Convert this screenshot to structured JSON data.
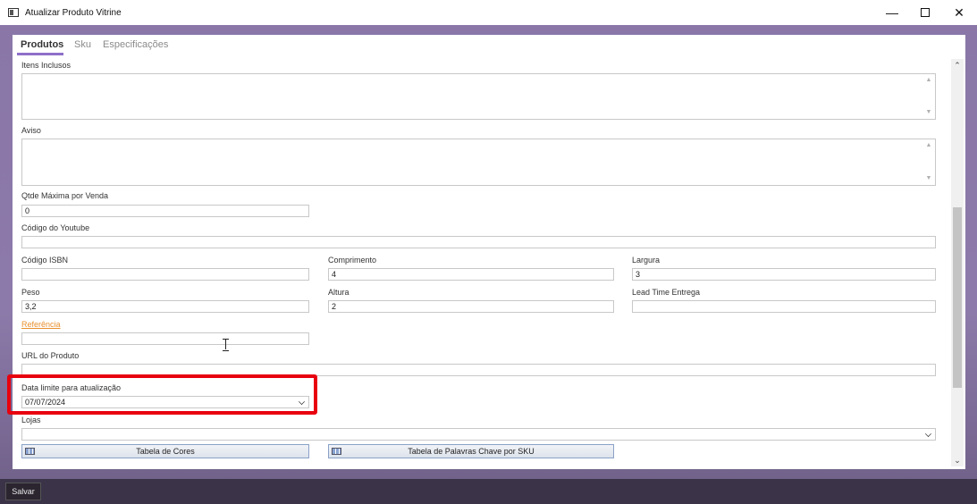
{
  "window": {
    "title": "Atualizar Produto Vitrine",
    "minimize": "—",
    "close": "✕"
  },
  "tabs": [
    {
      "label": "Produtos",
      "active": true
    },
    {
      "label": "Sku",
      "active": false
    },
    {
      "label": "Especificações",
      "active": false
    }
  ],
  "form": {
    "itens_inclusos": {
      "label": "Itens Inclusos",
      "value": ""
    },
    "aviso": {
      "label": "Aviso",
      "value": ""
    },
    "qtde_maxima": {
      "label": "Qtde Máxima por Venda",
      "value": "0"
    },
    "codigo_youtube": {
      "label": "Código do Youtube",
      "value": ""
    },
    "codigo_isbn": {
      "label": "Código ISBN",
      "value": ""
    },
    "comprimento": {
      "label": "Comprimento",
      "value": "4"
    },
    "largura": {
      "label": "Largura",
      "value": "3"
    },
    "peso": {
      "label": "Peso",
      "value": "3,2"
    },
    "altura": {
      "label": "Altura",
      "value": "2"
    },
    "lead_time": {
      "label": "Lead Time Entrega",
      "value": ""
    },
    "referencia": {
      "label": "Referência",
      "value": ""
    },
    "url_produto": {
      "label": "URL do Produto",
      "value": ""
    },
    "data_limite": {
      "label": "Data limite para atualização",
      "value": "07/07/2024"
    },
    "lojas": {
      "label": "Lojas",
      "value": ""
    }
  },
  "buttons": {
    "tabela_cores": "Tabela de Cores",
    "tabela_palavras": "Tabela de Palavras Chave por SKU",
    "salvar": "Salvar"
  },
  "colors": {
    "tab_accent": "#8e6fc9",
    "highlight": "#e8000f",
    "link": "#e8902e",
    "frame": "#8a77a8"
  }
}
